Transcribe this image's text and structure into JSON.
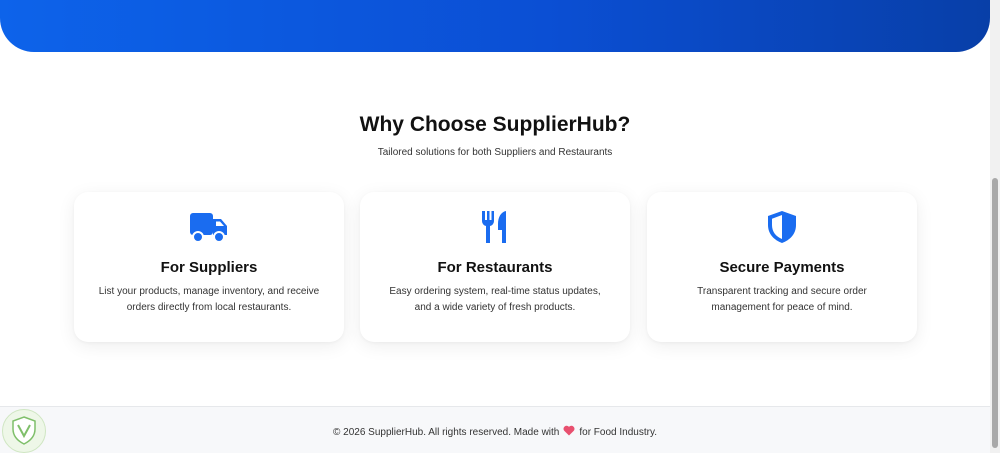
{
  "features": {
    "title": "Why Choose SupplierHub?",
    "subtitle": "Tailored solutions for both Suppliers and Restaurants",
    "cards": [
      {
        "icon": "truck-icon",
        "title": "For Suppliers",
        "desc_line1": "List your products, manage inventory, and receive",
        "desc_line2": "orders directly from local restaurants."
      },
      {
        "icon": "utensils-icon",
        "title": "For Restaurants",
        "desc_line1": "Easy ordering system, real-time status updates,",
        "desc_line2": "and a wide variety of fresh products."
      },
      {
        "icon": "shield-icon",
        "title": "Secure Payments",
        "desc_line1": "Transparent tracking and secure order",
        "desc_line2": "management for peace of mind."
      }
    ]
  },
  "footer": {
    "text_before": "© 2026 SupplierHub. All rights reserved. Made with",
    "text_after": "for Food Industry."
  },
  "colors": {
    "primary": "#0d63ea",
    "icon": "#1a6cf0",
    "heart": "#e8506f"
  }
}
